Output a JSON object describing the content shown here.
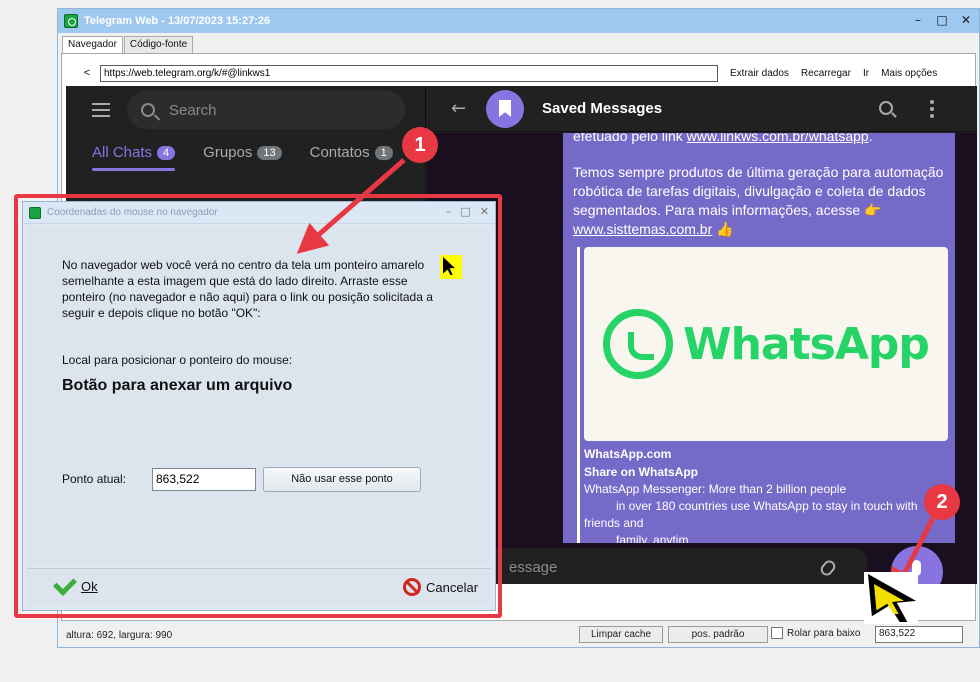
{
  "window": {
    "title": "Telegram Web - 13/07/2023 15:27:26",
    "controls": {
      "minimize": "–",
      "maximize": "□",
      "close": "✕"
    }
  },
  "tabs": [
    {
      "label": "Navegador",
      "active": true
    },
    {
      "label": "Código-fonte",
      "active": false
    }
  ],
  "urlbar": {
    "back": "<",
    "url": "https://web.telegram.org/k/#@linkws1",
    "actions": [
      "Extrair dados",
      "Recarregar",
      "Ir",
      "Mais opções"
    ]
  },
  "telegram": {
    "search_placeholder": "Search",
    "chat_tabs": [
      {
        "label": "All Chats",
        "count": "4",
        "active": true
      },
      {
        "label": "Grupos",
        "count": "13",
        "active": false
      },
      {
        "label": "Contatos",
        "count": "1",
        "active": false
      }
    ],
    "chat_title": "Saved Messages",
    "message": {
      "top_line_prefix": "efetuado pelo link ",
      "top_link": "www.linkws.com.br/whatsapp",
      "top_line_suffix": ".",
      "body_text": "Temos sempre produtos de última geração para automação robótica de tarefas digitais, divulgação e coleta de dados segmentados. Para mais informações, acesse 👉 ",
      "body_link": "www.sisttemas.com.br",
      "body_emoji": " 👍",
      "preview_brand": "WhatsApp",
      "preview_site": "WhatsApp.com",
      "preview_title": "Share on WhatsApp",
      "preview_desc_1": "WhatsApp Messenger: More than 2 billion people",
      "preview_desc_2": "in over 180 countries use WhatsApp to stay in touch with",
      "preview_desc_3": "friends and",
      "preview_desc_4": "family, anytim"
    },
    "composer_placeholder": "essage"
  },
  "statusbar": {
    "dims": "altura: 692, largura: 990",
    "clear_cache": "Limpar cache",
    "default_pos": "pos. padrão",
    "scroll_down": "Rolar para baixo",
    "coords": "863,522"
  },
  "dialog": {
    "title": "Coordenadas do mouse no navegador",
    "instructions": "No navegador web você verá no centro da tela um ponteiro amarelo semelhante a esta imagem que está do lado direito. Arraste esse ponteiro (no navegador e não aqui) para o link ou posição solicitada a seguir e depois clique no botão \"OK\":",
    "target_label": "Local para posicionar o ponteiro do mouse:",
    "target_value": "Botão para anexar um arquivo",
    "point_label": "Ponto atual:",
    "point_value": "863,522",
    "dont_use_label": "Não usar esse ponto",
    "ok_label": "Ok",
    "cancel_label": "Cancelar"
  },
  "markers": {
    "one": "1",
    "two": "2"
  },
  "colors": {
    "accent": "#8774e1",
    "highlight_red": "#e73843",
    "whatsapp_green": "#25d366",
    "pointer_yellow": "#ffff00"
  }
}
